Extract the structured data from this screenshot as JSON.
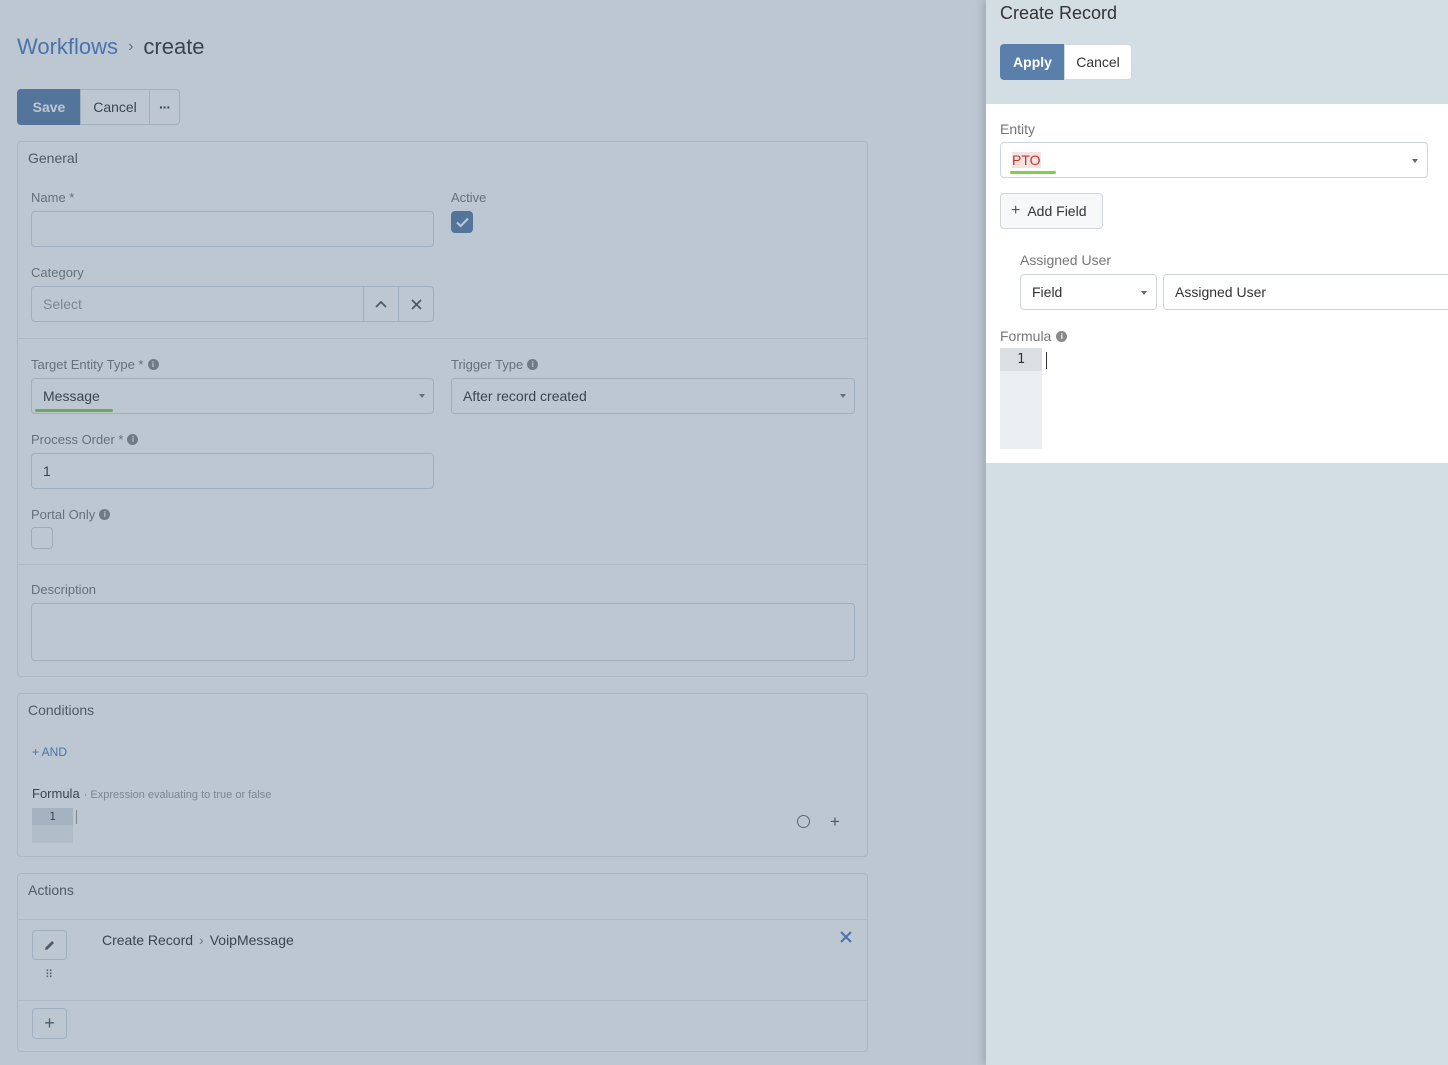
{
  "breadcrumb": {
    "root": "Workflows",
    "separator": "›",
    "current": "create"
  },
  "toolbar": {
    "save_label": "Save",
    "cancel_label": "Cancel",
    "more_label": "···"
  },
  "general": {
    "title": "General",
    "name_label": "Name *",
    "active_label": "Active",
    "active_checked": true,
    "category_label": "Category",
    "category_placeholder": "Select",
    "target_entity_label": "Target Entity Type *",
    "target_entity_value": "Message",
    "trigger_type_label": "Trigger Type",
    "trigger_type_value": "After record created",
    "process_order_label": "Process Order *",
    "process_order_value": "1",
    "portal_only_label": "Portal Only",
    "portal_only_checked": false,
    "description_label": "Description"
  },
  "conditions": {
    "title": "Conditions",
    "and_label": "+ AND",
    "formula_label": "Formula",
    "formula_hint": "· Expression evaluating to true or false",
    "line_number": "1"
  },
  "actions": {
    "title": "Actions",
    "item_label": "Create Record",
    "item_separator": "›",
    "item_entity": "VoipMessage"
  },
  "dialog": {
    "title": "Create Record",
    "apply_label": "Apply",
    "cancel_label": "Cancel",
    "entity_label": "Entity",
    "entity_value": "PTO",
    "add_field_label": "Add Field",
    "field_name_label": "Assigned User",
    "field_type_value": "Field",
    "field_value": "Assigned User",
    "formula_label": "Formula",
    "line_number": "1"
  },
  "colors": {
    "primary": "#5b7fab",
    "link": "#4a7cc4",
    "spellcheck_underline": "#7fd14a",
    "overlay_tint": "#46647f"
  }
}
